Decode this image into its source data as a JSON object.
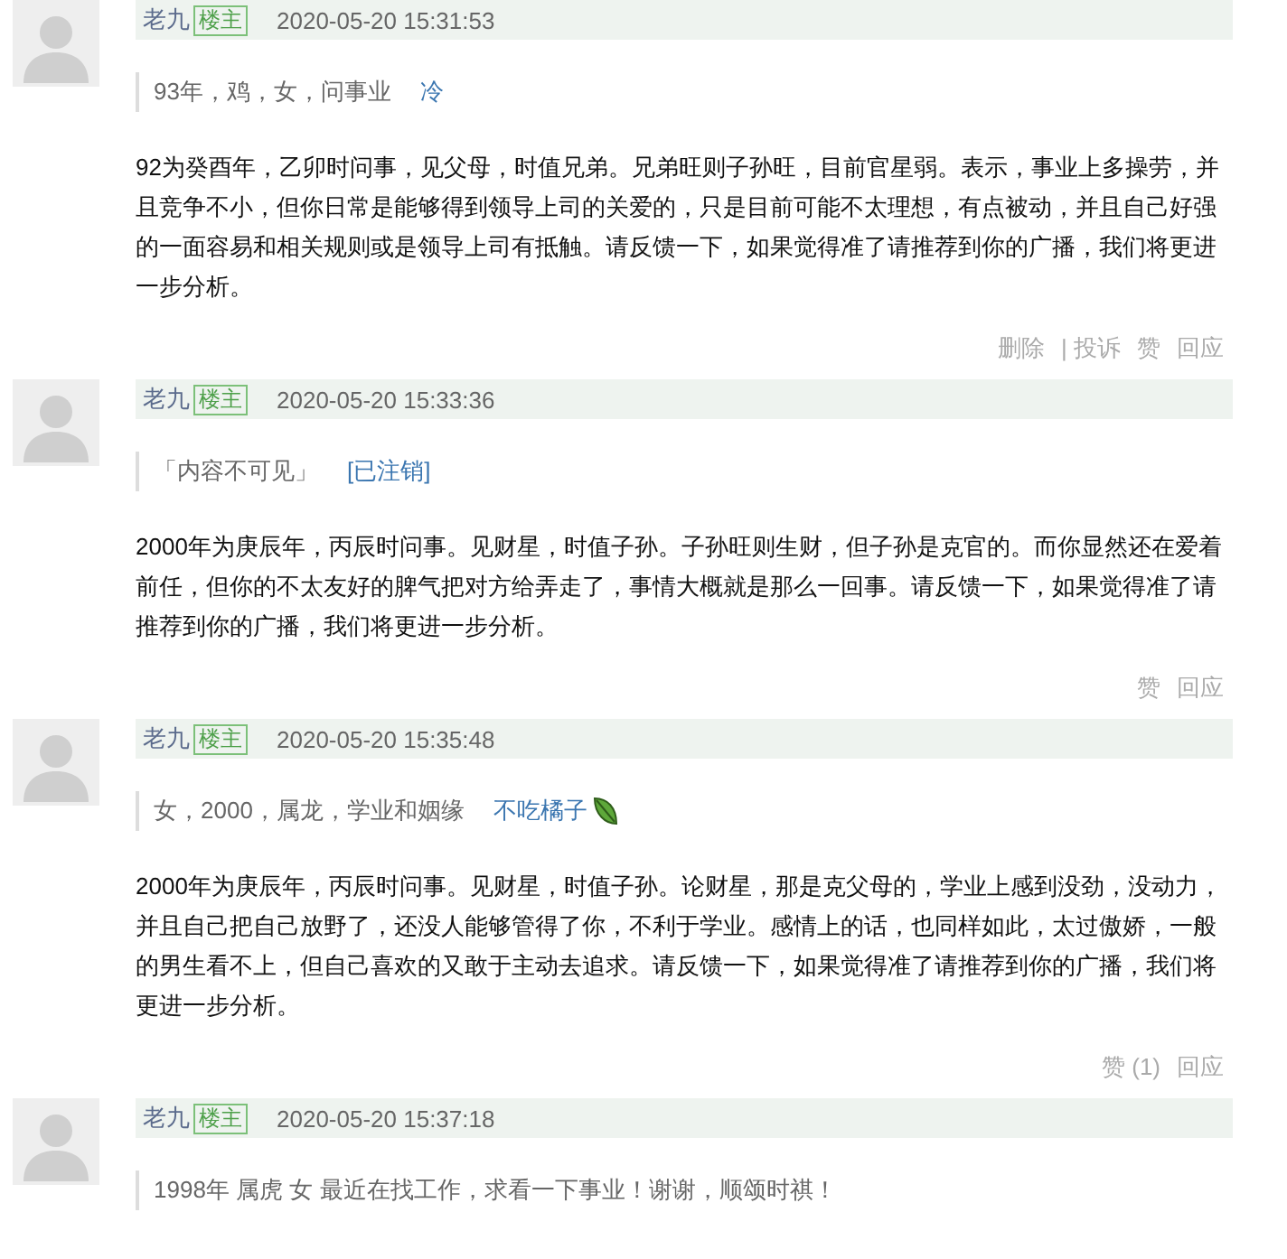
{
  "posts": [
    {
      "author": "老九",
      "badge": "楼主",
      "time": "2020-05-20 15:31:53",
      "quote": {
        "text": "93年，鸡，女，问事业",
        "user": "冷",
        "emoji": false
      },
      "body": "92为癸酉年，乙卯时问事，见父母，时值兄弟。兄弟旺则子孙旺，目前官星弱。表示，事业上多操劳，并且竞争不小，但你日常是能够得到领导上司的关爱的，只是目前可能不太理想，有点被动，并且自己好强的一面容易和相关规则或是领导上司有抵触。请反馈一下，如果觉得准了请推荐到你的广播，我们将更进一步分析。",
      "actions": [
        "删除",
        "| 投诉",
        "赞",
        "回应"
      ]
    },
    {
      "author": "老九",
      "badge": "楼主",
      "time": "2020-05-20 15:33:36",
      "quote": {
        "text": "「内容不可见」",
        "user": "[已注销]",
        "emoji": false
      },
      "body": "2000年为庚辰年，丙辰时问事。见财星，时值子孙。子孙旺则生财，但子孙是克官的。而你显然还在爱着前任，但你的不太友好的脾气把对方给弄走了，事情大概就是那么一回事。请反馈一下，如果觉得准了请推荐到你的广播，我们将更进一步分析。",
      "actions": [
        "赞",
        "回应"
      ]
    },
    {
      "author": "老九",
      "badge": "楼主",
      "time": "2020-05-20 15:35:48",
      "quote": {
        "text": "女，2000，属龙，学业和姻缘",
        "user": "不吃橘子",
        "emoji": true
      },
      "body": "2000年为庚辰年，丙辰时问事。见财星，时值子孙。论财星，那是克父母的，学业上感到没劲，没动力，并且自己把自己放野了，还没人能够管得了你，不利于学业。感情上的话，也同样如此，太过傲娇，一般的男生看不上，但自己喜欢的又敢于主动去追求。请反馈一下，如果觉得准了请推荐到你的广播，我们将更进一步分析。",
      "actions": [
        "赞 (1)",
        "回应"
      ]
    },
    {
      "author": "老九",
      "badge": "楼主",
      "time": "2020-05-20 15:37:18",
      "quote": {
        "text": "1998年 属虎 女 最近在找工作，求看一下事业！谢谢，顺颂时祺！"
      }
    }
  ]
}
